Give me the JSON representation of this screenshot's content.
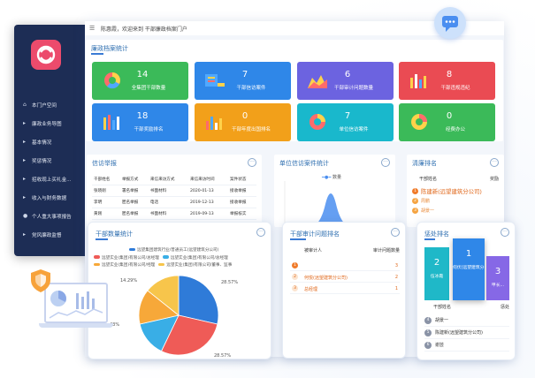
{
  "colors": {
    "sidebar": "#1d2d55",
    "accent": "#3a7bd5"
  },
  "header": {
    "welcome": "陈惠霞，欢迎来到 干部廉政档案门户"
  },
  "sidebar": {
    "items": [
      {
        "label": "本门户空间",
        "icon": "home-icon"
      },
      {
        "label": "廉政业务导图",
        "icon": "flag-icon"
      },
      {
        "label": "基本情况",
        "icon": "flag-icon"
      },
      {
        "label": "奖惩情况",
        "icon": "flag-icon"
      },
      {
        "label": "招收现上买礼金...",
        "icon": "flag-icon"
      },
      {
        "label": "收入与财务数据",
        "icon": "flag-icon"
      },
      {
        "label": "个人重大事项报告",
        "icon": "user-icon"
      },
      {
        "label": "党风廉政监督",
        "icon": "flag-icon"
      }
    ]
  },
  "stats": {
    "title": "廉政档案统计",
    "cards": [
      {
        "value": "14",
        "label": "全集团干部数量",
        "color": "#3bba59"
      },
      {
        "value": "7",
        "label": "干部信访案件",
        "color": "#2f87e8"
      },
      {
        "value": "6",
        "label": "干部审计问题数量",
        "color": "#6c63e0"
      },
      {
        "value": "8",
        "label": "干部违规违纪",
        "color": "#ea4b53"
      },
      {
        "value": "18",
        "label": "干部奖励排名",
        "color": "#2f87e8"
      },
      {
        "value": "0",
        "label": "干部年度出国排名",
        "color": "#f2a01a"
      },
      {
        "value": "7",
        "label": "单位信访案件",
        "color": "#19b8cc"
      },
      {
        "value": "0",
        "label": "经费办公",
        "color": "#3bba59"
      }
    ]
  },
  "petition": {
    "title": "信访举报",
    "headers": [
      "干部姓名",
      "举报方式",
      "来信来访方式",
      "来信来访时间",
      "案件状态"
    ],
    "rows": [
      [
        "张晓刚",
        "署名举报",
        "书面材料",
        "2020-01-13",
        "接收举报"
      ],
      [
        "李明",
        "匿名举报",
        "电话",
        "2019-12-13",
        "接收举报"
      ],
      [
        "黄刚",
        "匿名举报",
        "书面材料",
        "2019-09-13",
        "举报核实"
      ]
    ]
  },
  "unit_chart": {
    "title": "单位信访案件统计",
    "legend": "数量"
  },
  "cleanup": {
    "title": "清廉排名",
    "headers": [
      "干部姓名",
      "奖励"
    ],
    "rows": [
      {
        "rank": "1",
        "name": "陈建新(远望建筑分公司)"
      },
      {
        "rank": "2",
        "name": "周鹏"
      },
      {
        "rank": "3",
        "name": "胡景一"
      }
    ]
  },
  "cadre_chart": {
    "title": "干部数量统计",
    "legend": [
      "远望集团建筑行业/普通员工(远望建筑分公司)",
      "远望实业(集团)有限公司/总经理",
      "远望实业(集团)有限公司/总经理",
      "远望实业(集团)有限公司/经理",
      "远望实业(集团)有限公司/董事、监事"
    ],
    "labels": {
      "a": "14.29%",
      "b": "28.57%",
      "c": "43%",
      "d": "28.57%"
    }
  },
  "chart_data": {
    "type": "pie",
    "values": [
      28.57,
      28.57,
      14.29,
      14.29,
      14.29
    ],
    "colors": [
      "#2f7bd8",
      "#ef5b57",
      "#39aee6",
      "#f7a839",
      "#f7c54b"
    ],
    "labels": [
      "28.57%",
      "28.57%",
      "14.29%",
      "",
      "43%"
    ]
  },
  "audit": {
    "title": "干部审计问题排名",
    "headers": [
      "被审计人",
      "审计问题数量"
    ],
    "rows": [
      {
        "rank": "1",
        "name": "",
        "count": "3"
      },
      {
        "rank": "2",
        "name": "何悦(远望建筑分公司)",
        "count": "2"
      },
      {
        "rank": "3",
        "name": "总经理",
        "count": "1"
      }
    ]
  },
  "penalty": {
    "title": "惩处排名",
    "bars": [
      {
        "value": "2",
        "label": "伍冰霞"
      },
      {
        "value": "1",
        "label": "何伏(远望建筑分公司)"
      },
      {
        "value": "3",
        "label": "甲长..."
      }
    ],
    "headers": [
      "干部姓名",
      "惩处"
    ],
    "rows": [
      {
        "rank": "4",
        "name": "胡景一"
      },
      {
        "rank": "5",
        "name": "陈建新(远望建筑分公司)"
      },
      {
        "rank": "6",
        "name": "谢芸"
      }
    ]
  }
}
